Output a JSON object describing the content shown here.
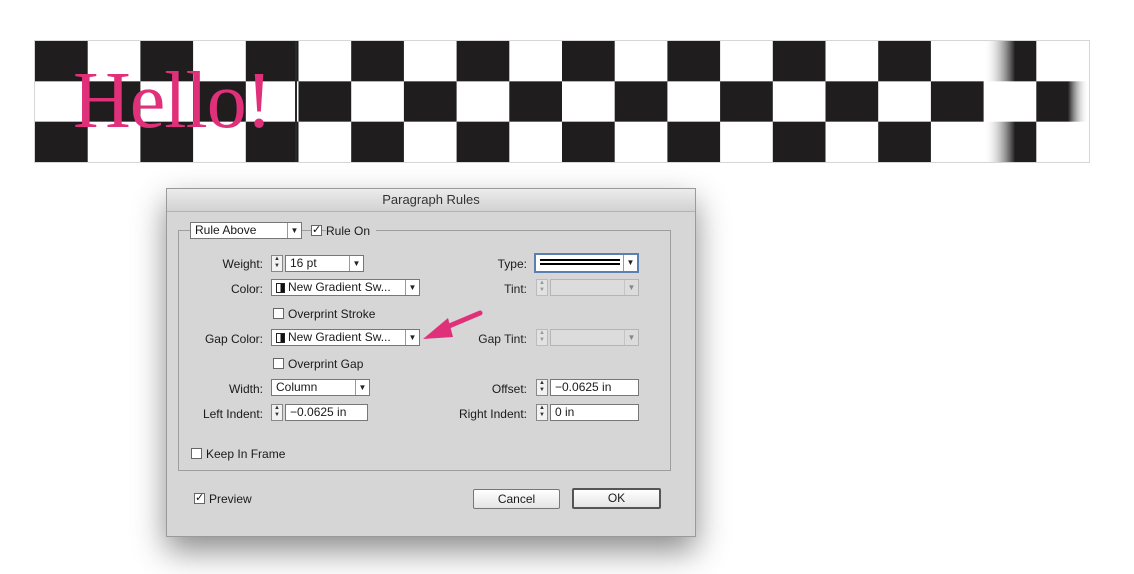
{
  "canvas": {
    "text": "Hello!",
    "text_color": "#e0307a",
    "checker_colors": [
      "#1f1d1d",
      "#ffffff"
    ]
  },
  "dialog": {
    "title": "Paragraph Rules",
    "rule_select": "Rule Above",
    "rule_on_label": "Rule On",
    "rule_on_checked": true,
    "weight_label": "Weight:",
    "weight_value": "16 pt",
    "type_label": "Type:",
    "color_label": "Color:",
    "color_value": "New Gradient Sw...",
    "tint_label": "Tint:",
    "overprint_stroke_label": "Overprint Stroke",
    "gap_color_label": "Gap Color:",
    "gap_color_value": "New Gradient Sw...",
    "gap_tint_label": "Gap Tint:",
    "overprint_gap_label": "Overprint Gap",
    "width_label": "Width:",
    "width_value": "Column",
    "offset_label": "Offset:",
    "offset_value": "−0.0625 in",
    "left_indent_label": "Left Indent:",
    "left_indent_value": "−0.0625 in",
    "right_indent_label": "Right Indent:",
    "right_indent_value": "0 in",
    "keep_in_frame_label": "Keep In Frame",
    "preview_label": "Preview",
    "preview_checked": true,
    "cancel_label": "Cancel",
    "ok_label": "OK"
  },
  "annotation": {
    "arrow_color": "#e0307a"
  }
}
